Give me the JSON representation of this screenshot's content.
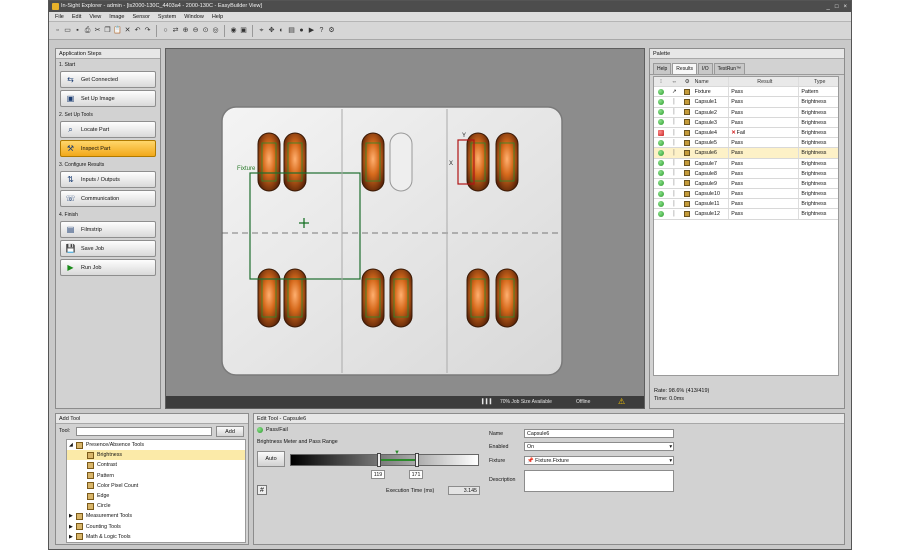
{
  "window": {
    "title": "In-Sight Explorer - admin - [is2000-130C_4403a4 - 2000-130C - EasyBuilder View]"
  },
  "menu": [
    "File",
    "Edit",
    "View",
    "Image",
    "Sensor",
    "System",
    "Window",
    "Help"
  ],
  "toolbar": {
    "icons": [
      "new-icon",
      "open-icon",
      "save-icon",
      "print-icon",
      "cut-icon",
      "copy-icon",
      "paste-icon",
      "delete-icon",
      "undo-icon",
      "redo-icon",
      "trigger-icon",
      "live-icon",
      "zoom-in-icon",
      "zoom-out-icon",
      "zoom-fit-icon",
      "zoom-100-icon",
      "online-icon",
      "camera-icon",
      "select-icon",
      "pan-icon",
      "graphics-icon",
      "filmstrip-icon",
      "record-icon",
      "playback-icon",
      "help-icon",
      "config-icon"
    ]
  },
  "steps": {
    "header": "Application Steps",
    "sections": [
      {
        "label": "1. Start",
        "items": [
          "Get Connected",
          "Set Up Image"
        ]
      },
      {
        "label": "2. Set Up Tools",
        "items": [
          "Locate Part",
          "Inspect Part"
        ]
      },
      {
        "label": "3. Configure Results",
        "items": [
          "Inputs / Outputs",
          "Communication"
        ]
      },
      {
        "label": "4. Finish",
        "items": [
          "Filmstrip",
          "Save Job",
          "Run Job"
        ]
      }
    ],
    "active": "Inspect Part"
  },
  "image": {
    "labels": {
      "fixture": "Fixture",
      "y": "Y",
      "x": "X"
    },
    "status": {
      "job_size": "70% Job Size Available",
      "state": "Offline"
    }
  },
  "palette": {
    "header": "Palette",
    "tabs": [
      "Help",
      "Results",
      "I/O",
      "TestRun™"
    ],
    "active_tab": "Results",
    "columns": [
      "Name",
      "Result",
      "Type"
    ],
    "rows": [
      {
        "name": "Fixture",
        "result": "Pass",
        "type": "Pattern",
        "ok": true
      },
      {
        "name": "Capsule1",
        "result": "Pass",
        "type": "Brightness",
        "ok": true
      },
      {
        "name": "Capsule2",
        "result": "Pass",
        "type": "Brightness",
        "ok": true
      },
      {
        "name": "Capsule3",
        "result": "Pass",
        "type": "Brightness",
        "ok": true
      },
      {
        "name": "Capsule4",
        "result": "Fail",
        "type": "Brightness",
        "ok": false
      },
      {
        "name": "Capsule5",
        "result": "Pass",
        "type": "Brightness",
        "ok": true
      },
      {
        "name": "Capsule6",
        "result": "Pass",
        "type": "Brightness",
        "ok": true,
        "selected": true
      },
      {
        "name": "Capsule7",
        "result": "Pass",
        "type": "Brightness",
        "ok": true
      },
      {
        "name": "Capsule8",
        "result": "Pass",
        "type": "Brightness",
        "ok": true
      },
      {
        "name": "Capsule9",
        "result": "Pass",
        "type": "Brightness",
        "ok": true
      },
      {
        "name": "Capsule10",
        "result": "Pass",
        "type": "Brightness",
        "ok": true
      },
      {
        "name": "Capsule11",
        "result": "Pass",
        "type": "Brightness",
        "ok": true
      },
      {
        "name": "Capsule12",
        "result": "Pass",
        "type": "Brightness",
        "ok": true
      }
    ],
    "rate": "Rate: 98.6% (413/419)",
    "time": "Time: 0.0ms"
  },
  "addtool": {
    "header": "Add Tool",
    "tool_label": "Tool:",
    "add_button": "Add",
    "tree": [
      {
        "label": "Presence/Absence Tools",
        "level": 0,
        "expanded": true
      },
      {
        "label": "Brightness",
        "level": 1,
        "selected": true
      },
      {
        "label": "Contrast",
        "level": 1
      },
      {
        "label": "Pattern",
        "level": 1
      },
      {
        "label": "Color Pixel Count",
        "level": 1
      },
      {
        "label": "Edge",
        "level": 1
      },
      {
        "label": "Circle",
        "level": 1
      },
      {
        "label": "Measurement Tools",
        "level": 0
      },
      {
        "label": "Counting Tools",
        "level": 0
      },
      {
        "label": "Math & Logic Tools",
        "level": 0
      }
    ]
  },
  "edittool": {
    "header": "Edit Tool - Capsule6",
    "passfail": "Pass/Fail",
    "meter_label": "Brightness Meter and Pass Range",
    "auto_button": "Auto",
    "low": "119",
    "high": "171",
    "exec_label": "Execution Time (ms)",
    "exec_value": "3.145",
    "name_label": "Name",
    "name_value": "Capsule6",
    "enabled_label": "Enabled",
    "enabled_value": "On",
    "fixture_label": "Fixture",
    "fixture_value": "Fixture.Fixture",
    "description_label": "Description"
  }
}
